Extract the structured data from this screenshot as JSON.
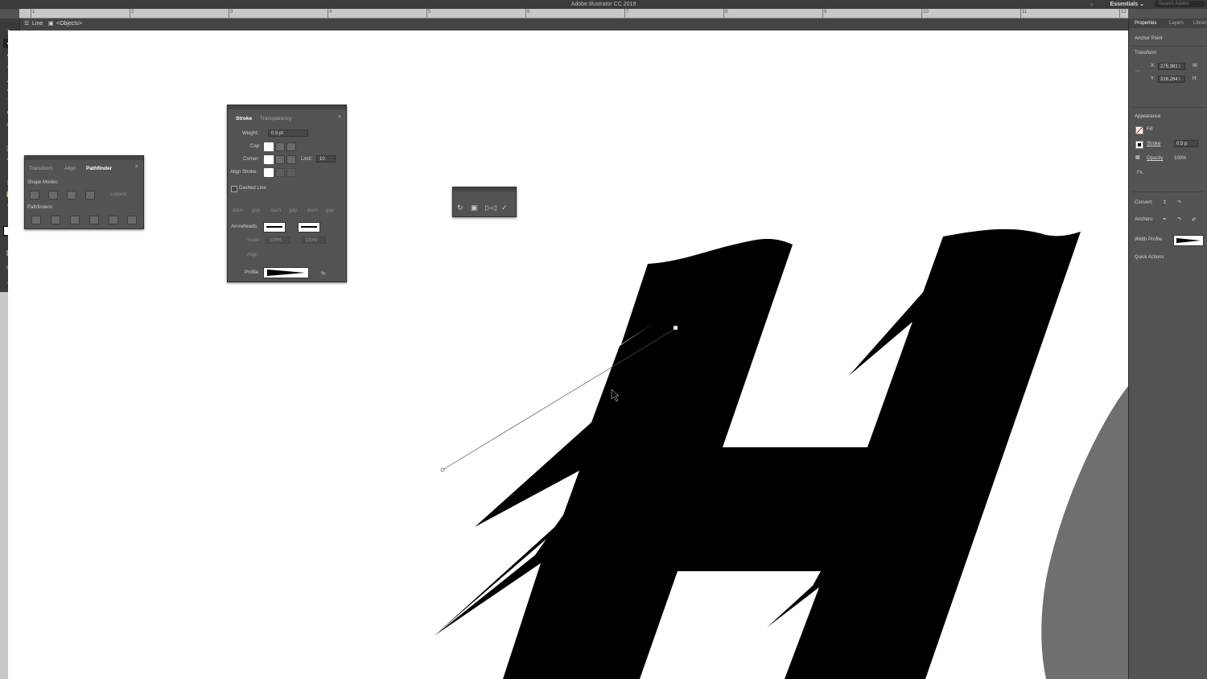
{
  "app": {
    "title": "Adobe Illustrator CC 2019",
    "workspace": "Essentials",
    "search_placeholder": "Search Adobe"
  },
  "ruler": {
    "ticks": [
      "1",
      "2",
      "3",
      "4",
      "5",
      "6",
      "7",
      "8",
      "9",
      "10",
      "11",
      "12"
    ]
  },
  "breadcrumb": {
    "layer": "Line",
    "object": "<Objects>"
  },
  "pathfinder_panel": {
    "tabs": [
      "Transform",
      "Align",
      "Pathfinder"
    ],
    "shape_modes_label": "Shape Modes:",
    "expand_label": "Expand",
    "pathfinders_label": "Pathfinders:"
  },
  "stroke_panel": {
    "tabs": [
      "Stroke",
      "Transparency"
    ],
    "weight_label": "Weight:",
    "weight_value": "0.5 pt",
    "cap_label": "Cap:",
    "corner_label": "Corner:",
    "limit_label": "Limit:",
    "limit_value": "10",
    "align_label": "Align Stroke:",
    "dashed_label": "Dashed Line",
    "dash_labels": [
      "dash",
      "gap",
      "dash",
      "gap",
      "dash",
      "gap"
    ],
    "arrowheads_label": "Arrowheads:",
    "scale_label": "Scale:",
    "scale_values": [
      "100%",
      "100%"
    ],
    "align_arrow_label": "Align:",
    "profile_label": "Profile:"
  },
  "properties_panel": {
    "tabs": [
      "Properties",
      "Layers",
      "Libraries"
    ],
    "selection_type": "Anchor Point",
    "transform_label": "Transform",
    "x_label": "X:",
    "x_value": "275.381 i",
    "y_label": "Y:",
    "y_value": "316.264 i",
    "w_label": "W:",
    "h_label": "H:",
    "appearance_label": "Appearance",
    "fill_label": "Fill",
    "stroke_label": "Stroke",
    "stroke_value": "0.5 p",
    "opacity_label": "Opacity",
    "opacity_value": "100%",
    "fx_label": "Fx.",
    "convert_label": "Convert:",
    "anchors_label": "Anchors:",
    "width_profile_label": "Width Profile",
    "quick_actions_label": "Quick Actions"
  },
  "colors": {
    "ui_dark": "#535353",
    "canvas": "#ffffff",
    "artwork": "#000000",
    "background_shape": "#6f6f6f"
  },
  "icons": {
    "tools": [
      "selection-tool",
      "direct-selection-tool",
      "pen-tool",
      "curvature-tool",
      "line-tool",
      "paintbrush-tool",
      "type-tool",
      "rotate-tool",
      "scissors-tool",
      "shaper-tool",
      "width-tool",
      "eyedropper-tool",
      "zoom-tool",
      "hand-tool"
    ]
  }
}
